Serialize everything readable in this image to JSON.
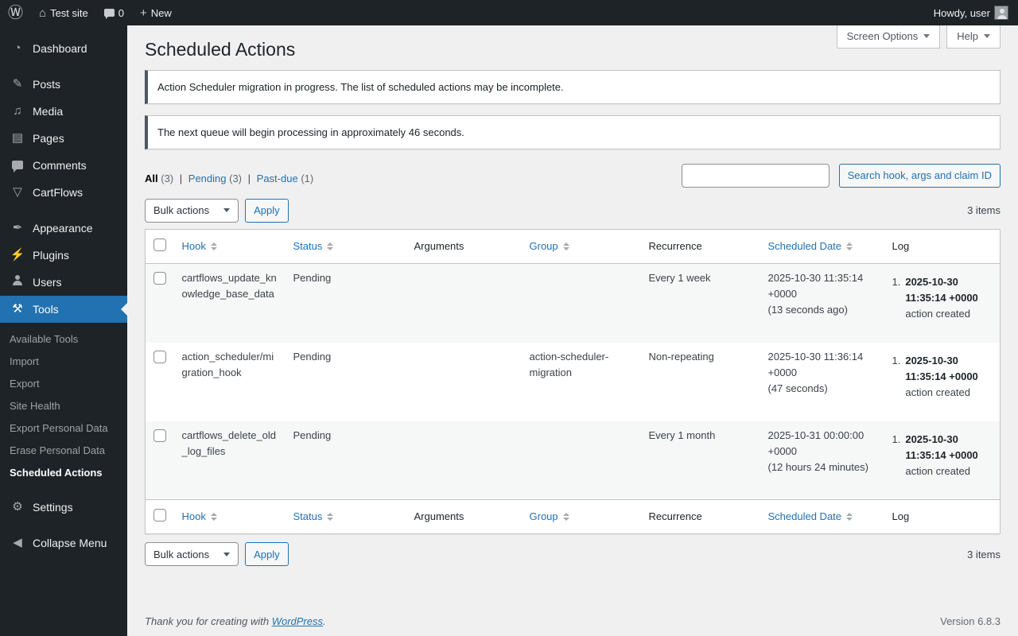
{
  "admin_bar": {
    "site_name": "Test site",
    "comments_count": "0",
    "new_label": "New",
    "howdy": "Howdy, user"
  },
  "sidebar": {
    "items": [
      "Dashboard",
      "Posts",
      "Media",
      "Pages",
      "Comments",
      "CartFlows",
      "Appearance",
      "Plugins",
      "Users",
      "Tools",
      "Settings"
    ],
    "tools_submenu": [
      "Available Tools",
      "Import",
      "Export",
      "Site Health",
      "Export Personal Data",
      "Erase Personal Data",
      "Scheduled Actions"
    ],
    "collapse_label": "Collapse Menu"
  },
  "page": {
    "title": "Scheduled Actions",
    "screen_options_label": "Screen Options",
    "help_label": "Help",
    "notices": [
      "Action Scheduler migration in progress. The list of scheduled actions may be incomplete.",
      "The next queue will begin processing in approximately 46 seconds."
    ],
    "filters": {
      "all_label": "All",
      "all_count": "(3)",
      "pending_label": "Pending",
      "pending_count": "(3)",
      "pastdue_label": "Past-due",
      "pastdue_count": "(1)",
      "sep": "|"
    },
    "search_button_label": "Search hook, args and claim ID",
    "bulk_actions_label": "Bulk actions",
    "apply_label": "Apply",
    "items_count": "3 items"
  },
  "table": {
    "headers": {
      "hook": "Hook",
      "status": "Status",
      "arguments": "Arguments",
      "group": "Group",
      "recurrence": "Recurrence",
      "scheduled_date": "Scheduled Date",
      "log": "Log"
    },
    "rows": [
      {
        "hook": "cartflows_update_knowledge_base_data",
        "status": "Pending",
        "arguments": "",
        "group": "",
        "recurrence": "Every 1 week",
        "scheduled_date": "2025-10-30 11:35:14 +0000",
        "scheduled_note": "(13 seconds ago)",
        "log_index": "1.",
        "log_date": "2025-10-30 11:35:14 +0000",
        "log_text": "action created"
      },
      {
        "hook": "action_scheduler/migration_hook",
        "status": "Pending",
        "arguments": "",
        "group": "action-scheduler-migration",
        "recurrence": "Non-repeating",
        "scheduled_date": "2025-10-30 11:36:14 +0000",
        "scheduled_note": "(47 seconds)",
        "log_index": "1.",
        "log_date": "2025-10-30 11:35:14 +0000",
        "log_text": "action created"
      },
      {
        "hook": "cartflows_delete_old_log_files",
        "status": "Pending",
        "arguments": "",
        "group": "",
        "recurrence": "Every 1 month",
        "scheduled_date": "2025-10-31 00:00:00 +0000",
        "scheduled_note": "(12 hours 24 minutes)",
        "log_index": "1.",
        "log_date": "2025-10-30 11:35:14 +0000",
        "log_text": "action created"
      }
    ]
  },
  "footer": {
    "thanks_text": "Thank you for creating with",
    "wordpress_link": "WordPress",
    "period": ".",
    "version": "Version 6.8.3"
  },
  "icons": {
    "wp_logo": "Ⓦ",
    "home": "⌂",
    "plus": "+",
    "dashboard": "◔",
    "posts": "✎",
    "media": "♫",
    "pages": "▤",
    "comments": "css-speech-bubble",
    "cartflows": "▽",
    "appearance": "✒",
    "plugins": "⚡",
    "users": "css-person",
    "tools": "⚒",
    "settings": "⚙",
    "collapse": "◀"
  },
  "colors": {
    "accent": "#2271b1",
    "admin_bar_bg": "#1d2327",
    "content_bg": "#f0f0f1",
    "notice_border": "#50575e"
  }
}
